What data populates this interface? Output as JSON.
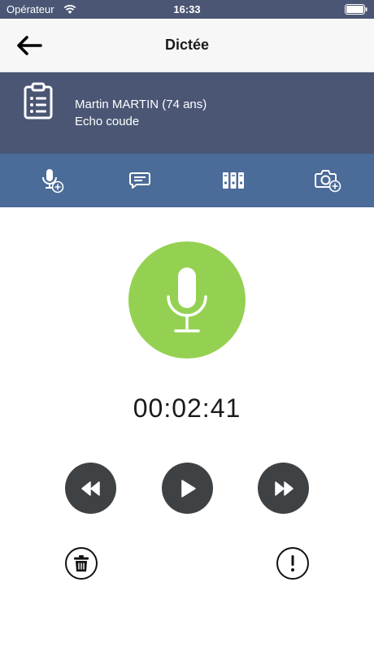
{
  "status_bar": {
    "carrier": "Opérateur",
    "time": "16:33",
    "wifi_icon": "wifi-icon",
    "battery_icon": "battery-icon"
  },
  "nav": {
    "title": "Dictée",
    "back_icon": "arrow-left-icon"
  },
  "patient": {
    "name": "Martin MARTIN (74 ans)",
    "exam": "Echo coude",
    "icon": "clipboard-list-icon"
  },
  "toolbar": {
    "items": [
      {
        "icon": "microphone-add-icon"
      },
      {
        "icon": "message-icon"
      },
      {
        "icon": "binders-icon"
      },
      {
        "icon": "camera-add-icon"
      }
    ]
  },
  "recorder": {
    "record_icon": "microphone-icon",
    "elapsed": "00:02:41",
    "controls": [
      "rewind-icon",
      "play-icon",
      "fast-forward-icon"
    ],
    "delete_icon": "trash-icon",
    "alert_icon": "exclamation-icon"
  },
  "colors": {
    "header_bg": "#4a5674",
    "toolbar_bg": "#4b6b98",
    "record_green": "#94d152",
    "control_dark": "#3e4244"
  }
}
